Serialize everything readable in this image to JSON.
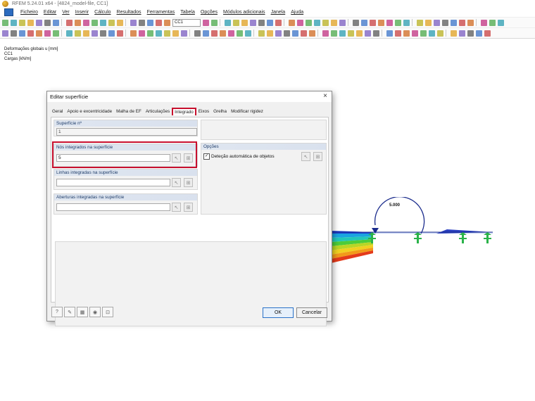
{
  "window": {
    "title": "RFEM 5.24.01 x64 - [4824_model-file, CC1]"
  },
  "menu": {
    "items": [
      "Ficheiro",
      "Editar",
      "Ver",
      "Inserir",
      "Cálculo",
      "Resultados",
      "Ferramentas",
      "Tabela",
      "Opções",
      "Módulos adicionais",
      "Janela",
      "Ajuda"
    ]
  },
  "toolbar": {
    "load_case": "CC1"
  },
  "workspace": {
    "labels": [
      "Deformações globais u [mm]",
      "CC1",
      "Cargas [kN/m]"
    ],
    "moment_label": "5.000"
  },
  "dialog": {
    "title": "Editar superfície",
    "close_glyph": "×",
    "tabs": [
      "Geral",
      "Apoio e excentricidade",
      "Malha de EF",
      "Articulações",
      "Integrado",
      "Eixos",
      "Grelha",
      "Modificar rigidez"
    ],
    "active_tab": "Integrado",
    "surface_no": {
      "label": "Superfície nº",
      "value": "1"
    },
    "integrated_nodes": {
      "label": "Nós integrados na superfície",
      "value": "5"
    },
    "integrated_lines": {
      "label": "Linhas integradas na superfície",
      "value": ""
    },
    "integrated_openings": {
      "label": "Aberturas integradas na superfície",
      "value": ""
    },
    "options": {
      "label": "Opções",
      "auto_detect_label": "Deteção automática de objetos",
      "auto_detect_checked": true,
      "check_glyph": "✓"
    },
    "ok_label": "OK",
    "cancel_label": "Cancelar"
  },
  "colors": {
    "accent_red": "#c8102e",
    "group_header": "#1f3d6a",
    "support_green": "#2bb34a",
    "moment_blue": "#1a2b8c"
  }
}
